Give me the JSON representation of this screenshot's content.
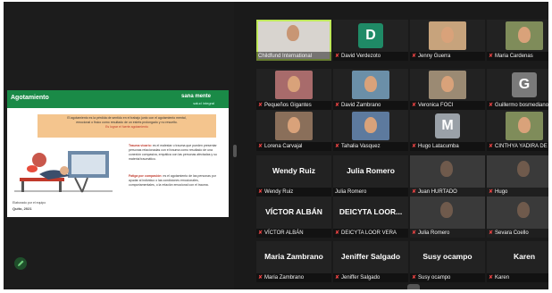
{
  "slide": {
    "title": "Agotamiento",
    "logo": "sana mente",
    "logo_sub": "salud integral",
    "box_line1": "El agotamiento es la pérdida de sentido en el trabajo junto con el agotamiento mental,",
    "box_line2": "emocional o físico como resultado de un estrés prolongado y no resuelto.",
    "box_line3": "Es lograr el fuerte agotamiento",
    "para1_bold": "Trauma vicario:",
    "para1": "es el malestar o trauma que pueden presentar personas relacionadas con el trauma como resultado de una conexión compasiva, empática con las personas afectadas y su material traumático.",
    "para2_bold": "Fatiga por compasión:",
    "para2": "es el agotamiento de las personas por ayudar al individuo o las condiciones emocionales, comportamentales, o la relación emocional con el trauma.",
    "footer": "Elaborado por el equipo",
    "footer2": "Quito, 2021"
  },
  "colors": {
    "active_border": "#bfe85a",
    "mic_muted": "#ff4747",
    "slide_header": "#1a8a47"
  },
  "participants": [
    {
      "name": "Childfund International",
      "kind": "video",
      "active": true,
      "muted": false
    },
    {
      "name": "David Verdezoto",
      "kind": "initial",
      "initial": "D",
      "bg": "#1f8a66",
      "muted": true
    },
    {
      "name": "Jenny Guerra",
      "kind": "photo",
      "muted": true
    },
    {
      "name": "Maria Cardenas",
      "kind": "photo",
      "muted": true
    },
    {
      "name": "Pequeños Gigantes",
      "kind": "photo",
      "muted": true
    },
    {
      "name": "David Zambrano",
      "kind": "photo",
      "muted": true
    },
    {
      "name": "Veronica FOCI",
      "kind": "photo",
      "muted": true
    },
    {
      "name": "Guillermo bosmediano",
      "kind": "initial",
      "initial": "G",
      "bg": "#7a7a7a",
      "muted": true
    },
    {
      "name": "Lorena Carvajal",
      "kind": "photo",
      "muted": true
    },
    {
      "name": "Tahalia Vasquez",
      "kind": "photo",
      "muted": true
    },
    {
      "name": "Hugo Latacumba",
      "kind": "initial",
      "initial": "M",
      "bg": "#9aa1a8",
      "muted": true
    },
    {
      "name": "CINTHYA YADIRA DE ...",
      "kind": "photo",
      "muted": true
    },
    {
      "name": "Wendy Ruiz",
      "kind": "text",
      "big": "Wendy Ruiz",
      "muted": true
    },
    {
      "name": "Julia Romero",
      "kind": "text",
      "big": "Julia Romero",
      "muted": false
    },
    {
      "name": "Juan HURTADO",
      "kind": "video",
      "muted": true
    },
    {
      "name": "Hugo",
      "kind": "video",
      "muted": true
    },
    {
      "name": "VÍCTOR ALBÁN",
      "kind": "text",
      "big": "VÍCTOR ALBÁN",
      "muted": true
    },
    {
      "name": "DEICYTA LOOR VERA",
      "kind": "text",
      "big": "DEICYTA LOOR...",
      "muted": true
    },
    {
      "name": "Julia Romero",
      "kind": "video",
      "muted": true
    },
    {
      "name": "Sevara Coello",
      "kind": "video",
      "muted": true
    },
    {
      "name": "Maria Zambrano",
      "kind": "text",
      "big": "Maria Zambrano",
      "muted": true
    },
    {
      "name": "Jeniffer Salgado",
      "kind": "text",
      "big": "Jeniffer Salgado",
      "muted": true
    },
    {
      "name": "Susy ocampo",
      "kind": "text",
      "big": "Susy ocampo",
      "muted": true
    },
    {
      "name": "Karen",
      "kind": "text",
      "big": "Karen",
      "muted": true
    }
  ]
}
